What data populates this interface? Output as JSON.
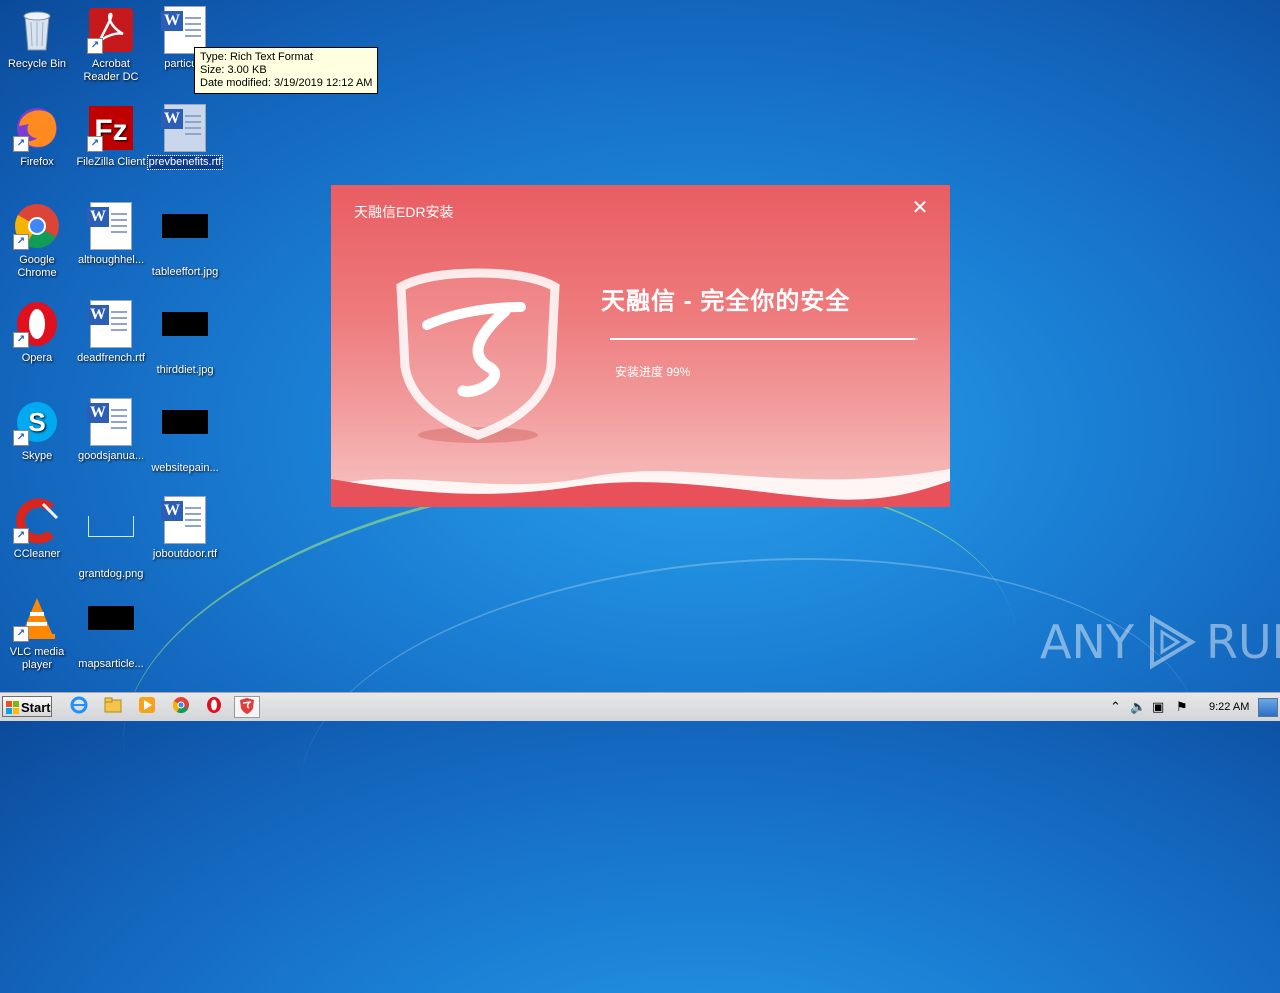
{
  "desktop": {
    "icons": {
      "recycle_bin": "Recycle Bin",
      "acrobat": "Acrobat Reader DC",
      "particula": "particula",
      "firefox": "Firefox",
      "filezilla": "FileZilla Client",
      "prevbenefits": "prevbenefits.rtf",
      "chrome": "Google Chrome",
      "althoughhel": "althoughhel...",
      "tableeffort": "tableeffort.jpg",
      "opera": "Opera",
      "deadfrench": "deadfrench.rtf",
      "thirddiet": "thirddiet.jpg",
      "skype": "Skype",
      "goodsjanua": "goodsjanua...",
      "websitepain": "websitepain...",
      "ccleaner": "CCleaner",
      "grantdog": "grantdog.png",
      "joboutdoor": "joboutdoor.rtf",
      "vlc": "VLC media player",
      "mapsarticle": "mapsarticle..."
    }
  },
  "tooltip": {
    "type": "Type: Rich Text Format",
    "size": "Size: 3.00 KB",
    "modified": "Date modified: 3/19/2019 12:12 AM"
  },
  "installer": {
    "title": "天融信EDR安装",
    "close": "✕",
    "headline": "天融信 - 完全你的安全",
    "progress_label": "安装进度 99%",
    "progress_fraction": 0.99
  },
  "watermark": {
    "left": "ANY",
    "right": "RUN"
  },
  "taskbar": {
    "start_label": "Start",
    "clock": "9:22 AM"
  },
  "colors": {
    "dialog_red": "#e85d62",
    "desktop_blue": "#1a7fd4"
  }
}
